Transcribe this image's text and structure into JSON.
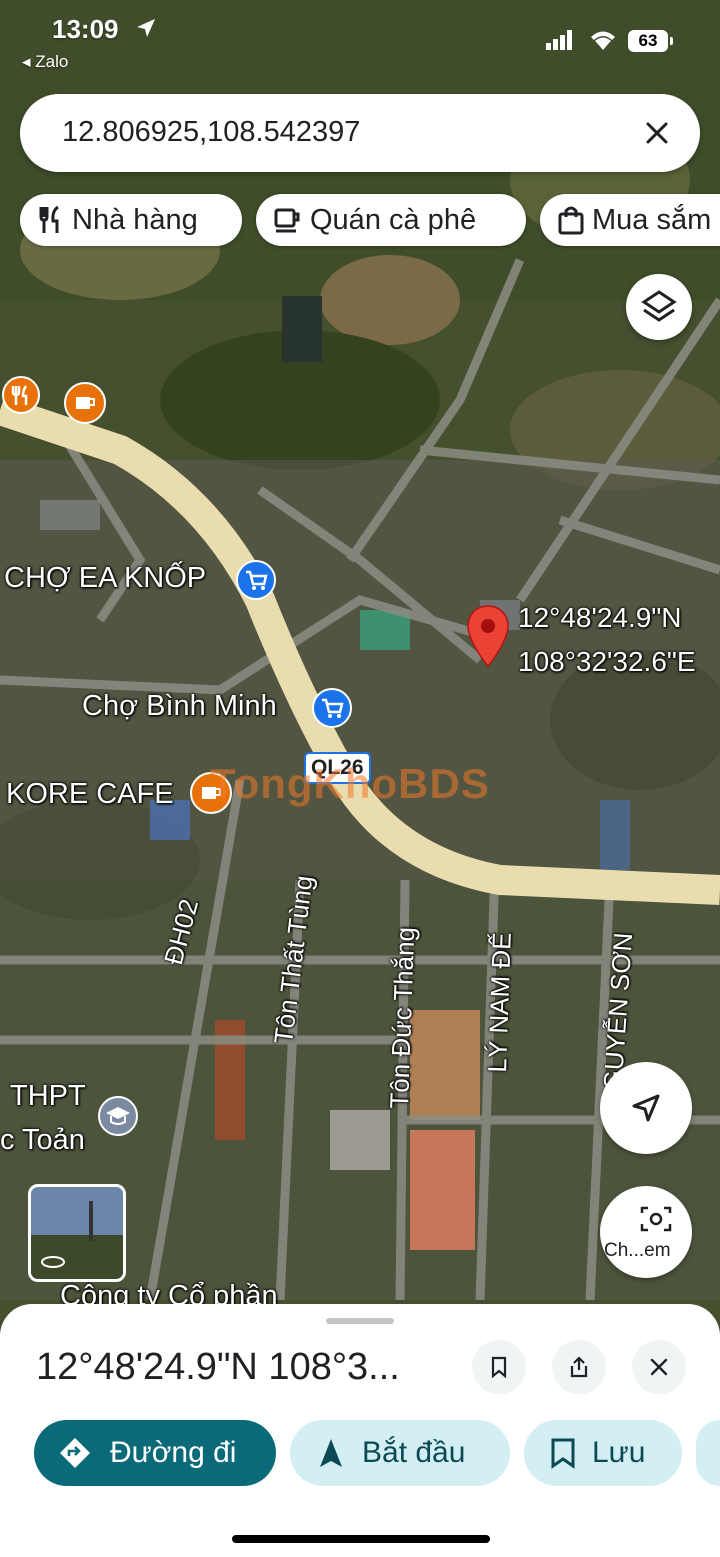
{
  "status_bar": {
    "time": "13:09",
    "back_app": "◂ Zalo",
    "battery": "63"
  },
  "search": {
    "query": "12.806925,108.542397"
  },
  "chips": [
    {
      "label": "Nhà hàng",
      "icon": "restaurant-icon"
    },
    {
      "label": "Quán cà phê",
      "icon": "coffee-icon"
    },
    {
      "label": "Mua sắm",
      "icon": "shopping-bag-icon"
    }
  ],
  "map": {
    "pin_label_line1": "12°48'24.9\"N",
    "pin_label_line2": "108°32'32.6\"E",
    "places": {
      "market1": "CHỢ EA KNỐP",
      "market2": "Chợ Bình Minh",
      "cafe": "KORE CAFE",
      "school_line1": "THPT",
      "school_line2": "c Toản",
      "company": "Công ty Cổ phần"
    },
    "road_shield": "QL26",
    "streets": {
      "dh02": "ĐH02",
      "ton_that_tung": "Tôn Thất Tùng",
      "ton_duc_thang": "Tôn Đức Thắng",
      "ly_nam_de": "LÝ NAM ĐẾ",
      "nguyen_son": "NGUYỄN SƠN"
    },
    "watermark": "TongKhoBDS",
    "lens_label": "Ch...em"
  },
  "sheet": {
    "title": "12°48'24.9\"N 108°3...",
    "directions": "Đường đi",
    "start": "Bắt đầu",
    "save": "Lưu"
  },
  "colors": {
    "accent_teal": "#0b6a78",
    "chip_teal_bg": "#d3eff4",
    "pin_red": "#ea4335",
    "road_beige": "#e9ddb0",
    "poi_orange": "#e8710a",
    "poi_blue": "#1a73e8"
  }
}
